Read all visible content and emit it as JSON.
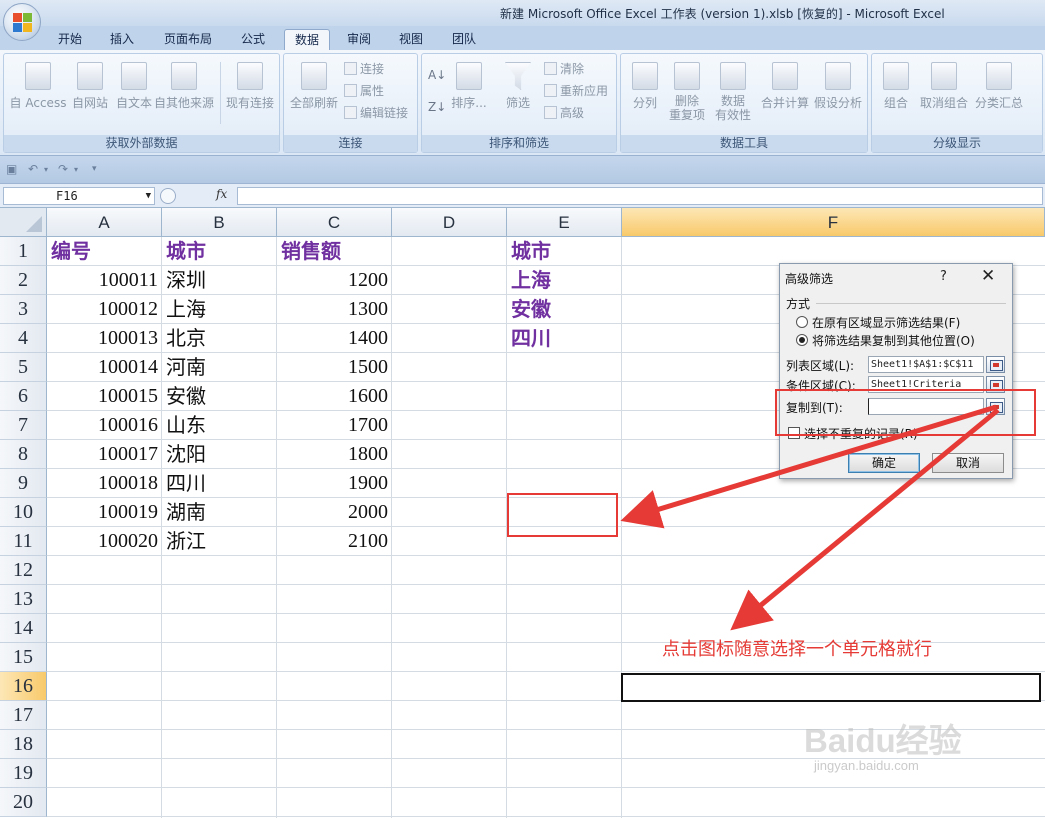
{
  "window": {
    "title": "新建 Microsoft Office Excel 工作表 (version 1).xlsb [恢复的] - Microsoft Excel"
  },
  "ribbon": {
    "tabs": [
      "开始",
      "插入",
      "页面布局",
      "公式",
      "数据",
      "审阅",
      "视图",
      "团队"
    ],
    "active_tab": "数据",
    "groups": {
      "external": {
        "label": "获取外部数据",
        "buttons": [
          "自 Access",
          "自网站",
          "自文本",
          "自其他来源",
          "现有连接"
        ]
      },
      "connections": {
        "label": "连接",
        "refresh": "全部刷新",
        "small": [
          "连接",
          "属性",
          "编辑链接"
        ]
      },
      "sortfilter": {
        "label": "排序和筛选",
        "sort": "排序...",
        "filter": "筛选",
        "small": [
          "清除",
          "重新应用",
          "高级"
        ]
      },
      "datatools": {
        "label": "数据工具",
        "buttons": [
          "分列",
          "删除\n重复项",
          "数据\n有效性",
          "合并计算",
          "假设分析"
        ]
      },
      "outline": {
        "label": "分级显示",
        "buttons": [
          "组合",
          "取消组合",
          "分类汇总"
        ]
      }
    }
  },
  "formula_bar": {
    "name_box": "F16",
    "fx_label": "fx",
    "content": ""
  },
  "sheet": {
    "columns": [
      "A",
      "B",
      "C",
      "D",
      "E",
      "F"
    ],
    "selected_column": "F",
    "rows": [
      "1",
      "2",
      "3",
      "4",
      "5",
      "6",
      "7",
      "8",
      "9",
      "10",
      "11",
      "12",
      "13",
      "14",
      "15",
      "16",
      "17",
      "18",
      "19",
      "20"
    ],
    "selected_row": "16",
    "headers": {
      "a1": "编号",
      "b1": "城市",
      "c1": "销售额",
      "e1": "城市"
    },
    "data": [
      [
        "100011",
        "深圳",
        "1200"
      ],
      [
        "100012",
        "上海",
        "1300"
      ],
      [
        "100013",
        "北京",
        "1400"
      ],
      [
        "100014",
        "河南",
        "1500"
      ],
      [
        "100015",
        "安徽",
        "1600"
      ],
      [
        "100016",
        "山东",
        "1700"
      ],
      [
        "100017",
        "沈阳",
        "1800"
      ],
      [
        "100018",
        "四川",
        "1900"
      ],
      [
        "100019",
        "湖南",
        "2000"
      ],
      [
        "100020",
        "浙江",
        "2100"
      ]
    ],
    "criteria": [
      "上海",
      "安徽",
      "四川"
    ]
  },
  "dialog": {
    "title": "高级筛选",
    "help": "?",
    "close": "✕",
    "mode_label": "方式",
    "option_in_place": "在原有区域显示筛选结果(F)",
    "option_copy": "将筛选结果复制到其他位置(O)",
    "list_range_label": "列表区域(L):",
    "list_range_value": "Sheet1!$A$1:$C$11",
    "criteria_range_label": "条件区域(C):",
    "criteria_range_value": "Sheet1!Criteria",
    "copy_to_label": "复制到(T):",
    "copy_to_value": "",
    "unique_label": "选择不重复的记录(R)",
    "ok": "确定",
    "cancel": "取消"
  },
  "annotation": {
    "text": "点击图标随意选择一个单元格就行",
    "color": "#e53a35"
  },
  "watermark": {
    "logo": "Baidu经验",
    "url": "jingyan.baidu.com"
  }
}
